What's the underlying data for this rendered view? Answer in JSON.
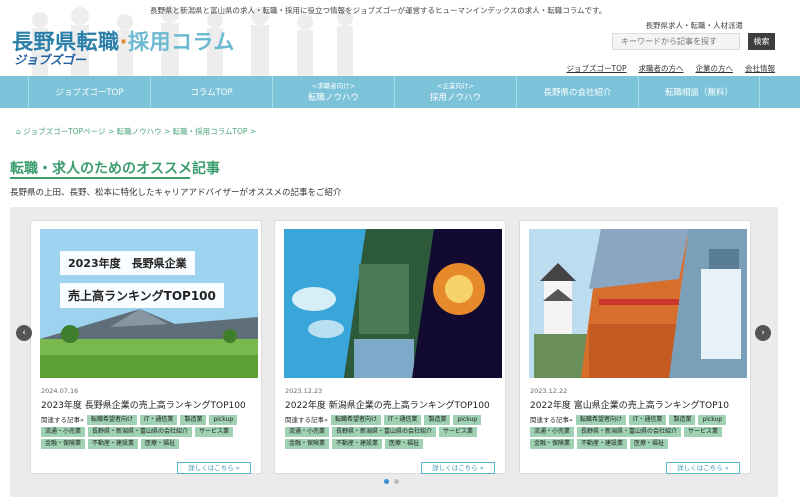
{
  "header": {
    "tagline": "長野県と新潟県と富山県の求人・転職・採用に役立つ情報をジョブズゴーが運営するヒューマンインデックスの求人・転職コラムです。",
    "logo_main": "長野県転職",
    "logo_dot": "·",
    "logo_second": "採用コラム",
    "logo_sub": "ジョブズゴー",
    "right_label": "長野県求人・転職・人材派遣",
    "search_placeholder": "キーワードから記事を探す",
    "search_button": "検索",
    "util_links": [
      "ジョブズゴーTOP",
      "求職者の方へ",
      "企業の方へ",
      "会社情報"
    ]
  },
  "nav": [
    {
      "small": "",
      "label": "ジョブズゴーTOP"
    },
    {
      "small": "",
      "label": "コラムTOP"
    },
    {
      "small": "<求職者向け>",
      "label": "転職ノウハウ"
    },
    {
      "small": "<企業向け>",
      "label": "採用ノウハウ"
    },
    {
      "small": "",
      "label": "長野県の会社紹介"
    },
    {
      "small": "",
      "label": "転職相談（無料）"
    }
  ],
  "breadcrumb": "ジョブズゴーTOPページ  >  転職ノウハウ  >  転職・採用コラムTOP  >",
  "breadcrumb_icon": "home-icon",
  "section": {
    "title": "転職・求人のためのオススメ記事",
    "desc": "長野県の上田、長野、松本に特化したキャリアアドバイザーがオススメの記事をご紹介"
  },
  "cards": [
    {
      "date": "2024.07.16",
      "title": "2023年度 長野県企業の売上高ランキングTOP100",
      "img_line1": "2023年度　長野県企業",
      "img_line2": "売上高ランキングTOP100",
      "tags_label": "関連する記事»",
      "tags": [
        "転職希望者向け",
        "IT・通信業",
        "製造業",
        "pickup",
        "流通・小売業",
        "長野県・新潟県・富山県の会社紹介",
        "サービス業",
        "金融・保険業",
        "不動産・建設業",
        "医療・福祉"
      ],
      "more": "詳しくはこちら »"
    },
    {
      "date": "2023.12.23",
      "title": "2022年度 新潟県企業の売上高ランキングTOP100",
      "img_line1": "",
      "img_line2": "",
      "tags_label": "関連する記事»",
      "tags": [
        "転職希望者向け",
        "IT・通信業",
        "製造業",
        "pickup",
        "流通・小売業",
        "長野県・新潟県・富山県の会社紹介",
        "サービス業",
        "金融・保険業",
        "不動産・建設業",
        "医療・福祉"
      ],
      "more": "詳しくはこちら »"
    },
    {
      "date": "2023.12.22",
      "title": "2022年度 富山県企業の売上高ランキングTOP10",
      "img_line1": "",
      "img_line2": "",
      "tags_label": "関連する記事»",
      "tags": [
        "転職希望者向け",
        "IT・通信業",
        "製造業",
        "pickup",
        "流通・小売業",
        "長野県・新潟県・富山県の会社紹介",
        "サービス業",
        "金融・保険業",
        "不動産・建設業",
        "医療・福祉"
      ],
      "more": "詳しくはこちら »"
    }
  ],
  "carousel": {
    "prev": "‹",
    "next": "›",
    "page_count": 2,
    "active_page": 1
  },
  "colors": {
    "nav": "#7cc3d9",
    "accent_green": "#3b9c6e",
    "tag": "#9ed2b3",
    "logo_blue": "#2a7fa8"
  }
}
